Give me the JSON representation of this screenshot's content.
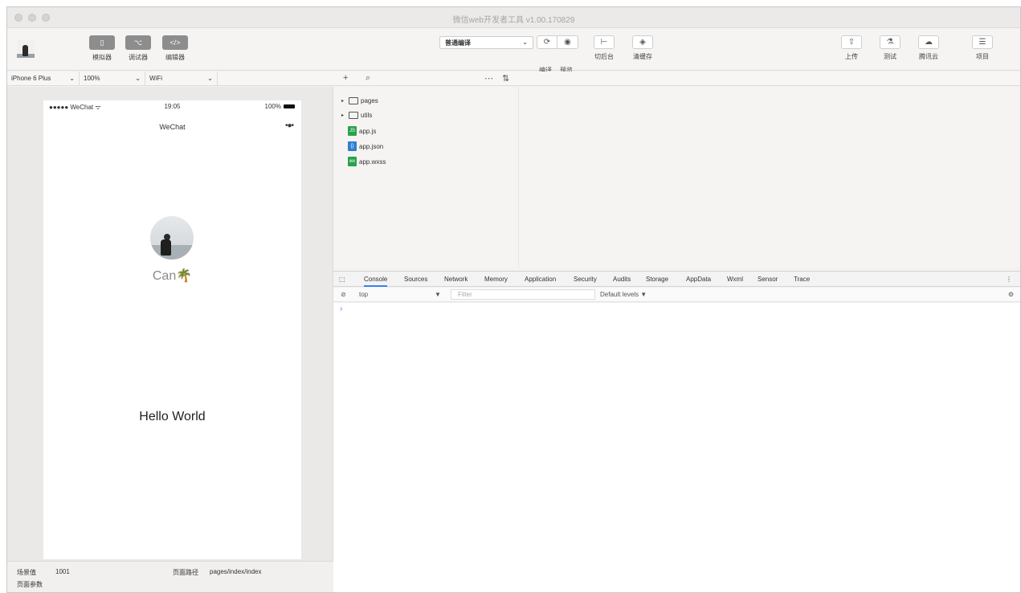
{
  "window": {
    "title": "微信web开发者工具 v1.00.170829"
  },
  "toolbar": {
    "left_buttons": [
      {
        "icon": "phone-icon",
        "glyph": "▯",
        "label": "模拟器"
      },
      {
        "icon": "debugger-icon",
        "glyph": "⌥",
        "label": "调试器"
      },
      {
        "icon": "code-icon",
        "glyph": "</>",
        "label": "编辑器"
      }
    ],
    "compile_mode": "普通编译",
    "compile_glyph": "⌄",
    "compile_label": "编译",
    "preview_label": "预览",
    "refresh_glyph": "⟳",
    "preview_glyph": "◉",
    "backend_glyph": "⊢",
    "backend_label": "切后台",
    "cache_glyph": "◈",
    "cache_label": "清缓存",
    "right_buttons": [
      {
        "glyph": "⇧",
        "label": "上传"
      },
      {
        "glyph": "⚗",
        "label": "测试"
      },
      {
        "glyph": "☁",
        "label": "腾讯云"
      },
      {
        "glyph": "☰",
        "label": "项目"
      }
    ]
  },
  "simulator_bar": {
    "device": "iPhone 6 Plus",
    "zoom": "100%",
    "network": "WiFi",
    "chev": "⌄"
  },
  "editor_bar": {
    "add": "+",
    "search": "⌕",
    "collapse": "⋯",
    "sort": "⇅"
  },
  "phone": {
    "carrier": "●●●●● WeChat ᯤ",
    "time": "19:05",
    "battery": "100%",
    "nav_title": "WeChat",
    "nav_more": "•●•",
    "nickname": "Can🌴",
    "hello": "Hello World"
  },
  "sim_footer": {
    "scene_label": "场景值",
    "scene_value": "1001",
    "path_label": "页面路径",
    "path_value": "pages/index/index",
    "params_label": "页面参数"
  },
  "file_tree": {
    "folders": [
      "pages",
      "utils"
    ],
    "files": [
      {
        "name": "app.js",
        "tag": "JS"
      },
      {
        "name": "app.json",
        "tag": "{}"
      },
      {
        "name": "app.wxss",
        "tag": "wx"
      }
    ],
    "tri": "▸"
  },
  "devtools": {
    "inspect_glyph": "⬚",
    "tabs": [
      "Console",
      "Sources",
      "Network",
      "Memory",
      "Application",
      "Security",
      "Audits",
      "Storage",
      "AppData",
      "Wxml",
      "Sensor",
      "Trace"
    ],
    "menu_glyph": "⋮",
    "clear_glyph": "⊘",
    "context": "top",
    "context_glyph": "▼",
    "filter_placeholder": "Filter",
    "levels": "Default levels ▼",
    "settings_glyph": "⚙",
    "prompt": "›"
  }
}
